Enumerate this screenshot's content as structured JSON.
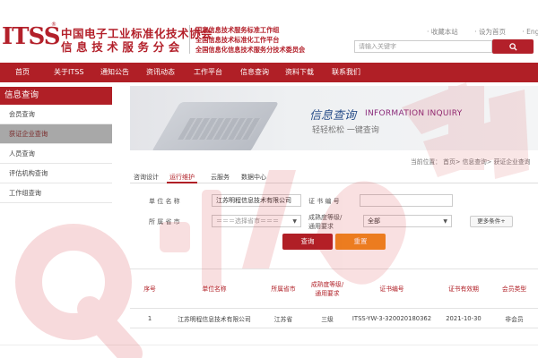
{
  "header": {
    "logo_mark": "ITSS",
    "logo_reg": "®",
    "logo_cn_line1": "中国电子工业标准化技术协会",
    "logo_cn_line2": "信息技术服务分会",
    "orgs": [
      "国家信息技术服务标准工作组",
      "全国信息技术标准化工作平台",
      "全国信息化信息技术服务分技术委员会"
    ],
    "top_links": [
      "收藏本站",
      "设为首页",
      "English"
    ],
    "search_placeholder": "请输入关键字",
    "search_icon": "search-icon"
  },
  "nav": {
    "items": [
      "首页",
      "关于ITSS",
      "通知公告",
      "资讯动态",
      "工作平台",
      "信息查询",
      "资料下载",
      "联系我们"
    ]
  },
  "sidebar": {
    "title": "信息查询",
    "items": [
      {
        "label": "会员查询",
        "active": false
      },
      {
        "label": "获证企业查询",
        "active": true
      },
      {
        "label": "人员查询",
        "active": false
      },
      {
        "label": "评估机构查询",
        "active": false
      },
      {
        "label": "工作组查询",
        "active": false
      }
    ]
  },
  "banner": {
    "title": "信息查询",
    "subtitle": "INFORMATION INQUIRY",
    "slogan": "轻轻松松  一键查询"
  },
  "breadcrumb": "当前位置： 首页> 信息查询> 获证企业查询",
  "tabs": [
    {
      "label": "咨询设计",
      "active": false
    },
    {
      "label": "运行维护",
      "active": true
    },
    {
      "label": "云服务",
      "active": false
    },
    {
      "label": "数据中心",
      "active": false
    }
  ],
  "form": {
    "unit_label": "单 位 名 称",
    "unit_value": "江苏明程信息技术有限公司",
    "cert_label": "证 书 编 号",
    "cert_value": "",
    "province_label": "所 属 省 市",
    "province_value": "＝＝＝选择省市＝＝＝",
    "level_label_1": "成熟度等级/",
    "level_label_2": "通用要求",
    "level_value": "全部",
    "more_button": "更多条件+",
    "query_button": "查询",
    "reset_button": "重置"
  },
  "table": {
    "headers": [
      "序号",
      "单位名称",
      "所属省市",
      "成熟度等级/通用要求",
      "证书编号",
      "证书有效期",
      "会员类型"
    ],
    "rows": [
      [
        "1",
        "江苏明程信息技术有限公司",
        "江苏省",
        "三级",
        "ITSS-YW-3-320020180362",
        "2021-10-30",
        "非会员"
      ]
    ]
  },
  "colors": {
    "brand_red": "#b01f26",
    "accent_orange": "#f08b1e",
    "banner_blue": "#2a4f8a"
  }
}
